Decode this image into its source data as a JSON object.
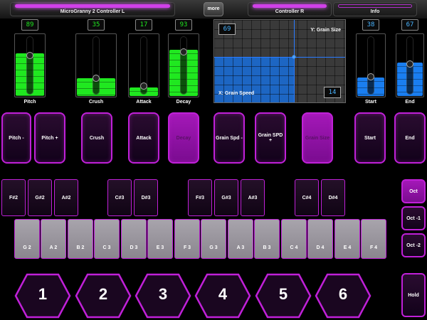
{
  "colors": {
    "accent": "#c020d8",
    "green": "#20e820",
    "blue": "#1a7ef0",
    "active_pad": "#a418b8"
  },
  "tabs": {
    "left_label": "MicroGranny 2 Controller L",
    "more_label": "more",
    "right_label": "Controller R",
    "info_label": "Info"
  },
  "sliders_left": [
    {
      "label": "Pitch",
      "readout": "89",
      "level": 0.68
    },
    {
      "label": "Crush",
      "readout": "35",
      "level": 0.28
    },
    {
      "label": "Attack",
      "readout": "17",
      "level": 0.14
    },
    {
      "label": "Decay",
      "readout": "93",
      "level": 0.74
    }
  ],
  "sliders_right": [
    {
      "label": "Start",
      "readout": "38",
      "level": 0.3
    },
    {
      "label": "End",
      "readout": "67",
      "level": 0.53
    }
  ],
  "xypad": {
    "x_label": "X: Grain Speed",
    "y_label": "Y: Grain Size",
    "y_readout": "69",
    "x_readout": "14",
    "x_level": 0.61,
    "y_level": 0.55
  },
  "pads": [
    {
      "label": "Pitch -",
      "active": false
    },
    {
      "label": "Pitch +",
      "active": false
    },
    {
      "label": "Crush",
      "active": false
    },
    {
      "label": "Attack",
      "active": false
    },
    {
      "label": "Decay",
      "active": true
    },
    {
      "label": "Grain Spd -",
      "active": false
    },
    {
      "label": "Grain SPD +",
      "active": false
    },
    {
      "label": "Grain Size",
      "active": true
    },
    {
      "label": "Start",
      "active": false
    },
    {
      "label": "End",
      "active": false
    }
  ],
  "black_keys": [
    "F#2",
    "G#2",
    "A#2",
    "C#3",
    "D#3",
    "F#3",
    "G#3",
    "A#3",
    "C#4",
    "D#4"
  ],
  "white_keys": [
    "G 2",
    "A 2",
    "B 2",
    "C 3",
    "D 3",
    "E 3",
    "F 3",
    "G 3",
    "A 3",
    "B 3",
    "C 4",
    "D 4",
    "E 4",
    "F 4"
  ],
  "octave_buttons": [
    {
      "label": "Oct",
      "active": true
    },
    {
      "label": "Oct -1",
      "active": false
    },
    {
      "label": "Oct -2",
      "active": false
    }
  ],
  "presets": [
    "1",
    "2",
    "3",
    "4",
    "5",
    "6"
  ],
  "hold_label": "Hold"
}
